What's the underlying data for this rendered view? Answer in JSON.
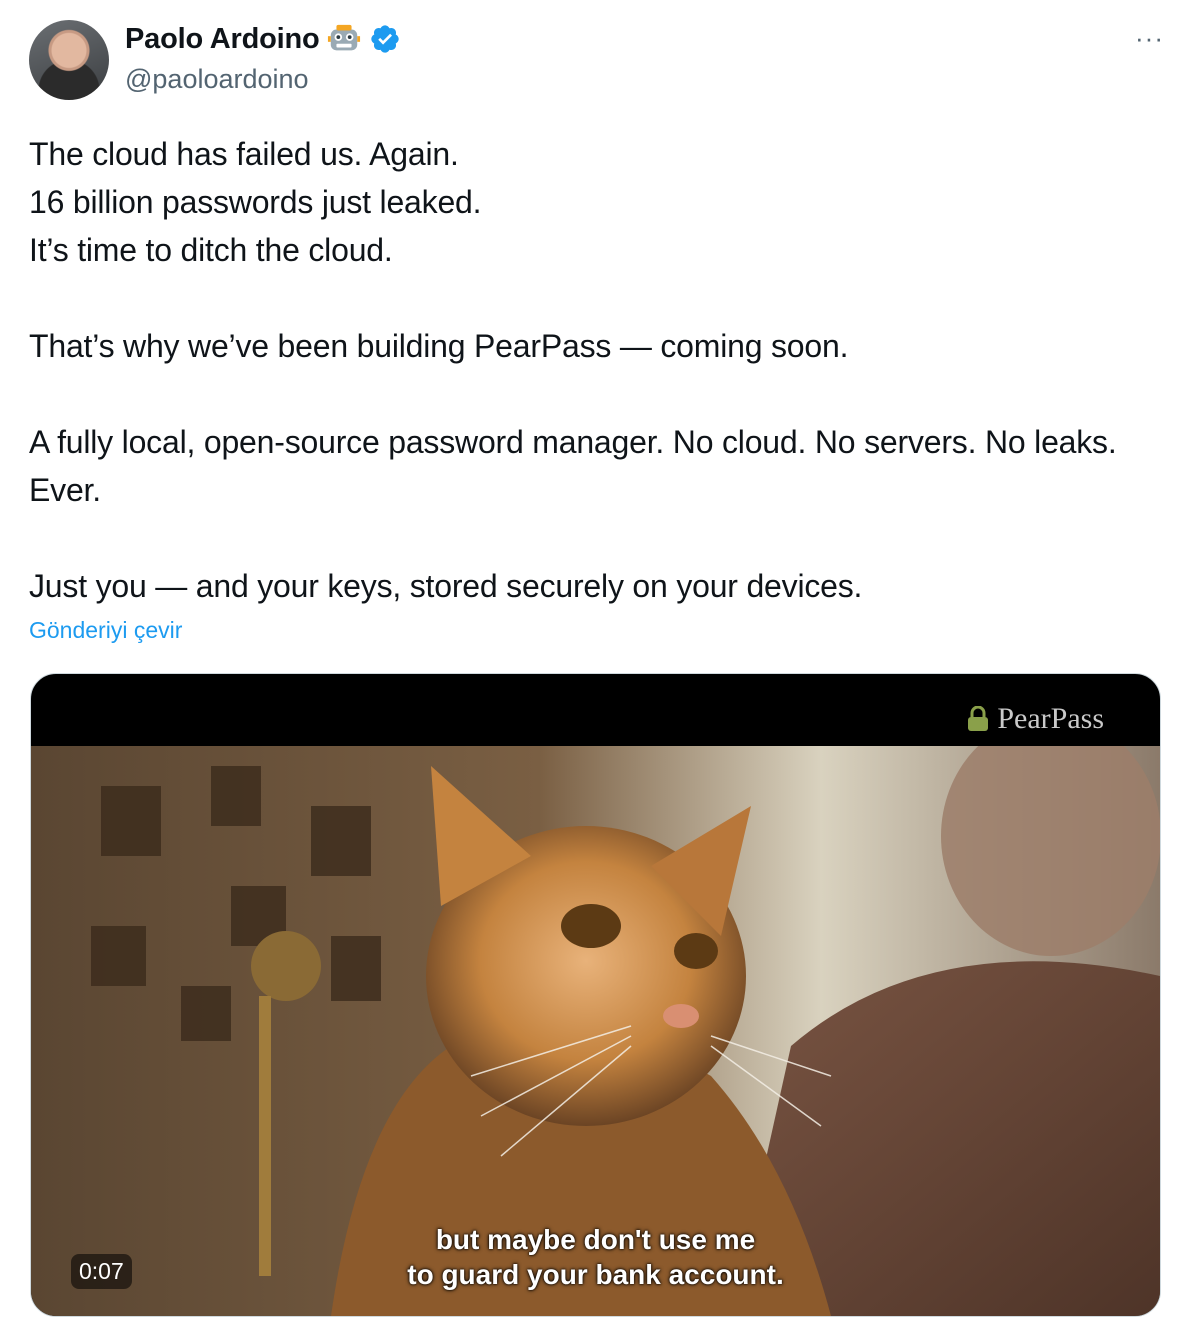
{
  "author": {
    "name": "Paolo Ardoino",
    "handle": "@paoloardoino",
    "emoji_icon": "robot-icon",
    "verified_icon": "verified-badge-icon"
  },
  "menu": {
    "more_label": "···"
  },
  "tweet": {
    "text": "The cloud has failed us. Again.\n16 billion passwords just leaked.\nIt’s time to ditch the cloud.\n\nThat’s why we’ve been building PearPass — coming soon.\n\nA fully local, open-source password manager. No cloud. No servers. No leaks. Ever.\n\nJust you — and your keys, stored securely on your devices.",
    "translate_label": "Gönderiyi çevir"
  },
  "media": {
    "brand": "PearPass",
    "timestamp": "0:07",
    "subtitle_line1": "but maybe don't use me",
    "subtitle_line2": "to guard your bank account."
  },
  "colors": {
    "link": "#1d9bf0",
    "secondary_text": "#536471",
    "verified": "#1d9bf0"
  }
}
